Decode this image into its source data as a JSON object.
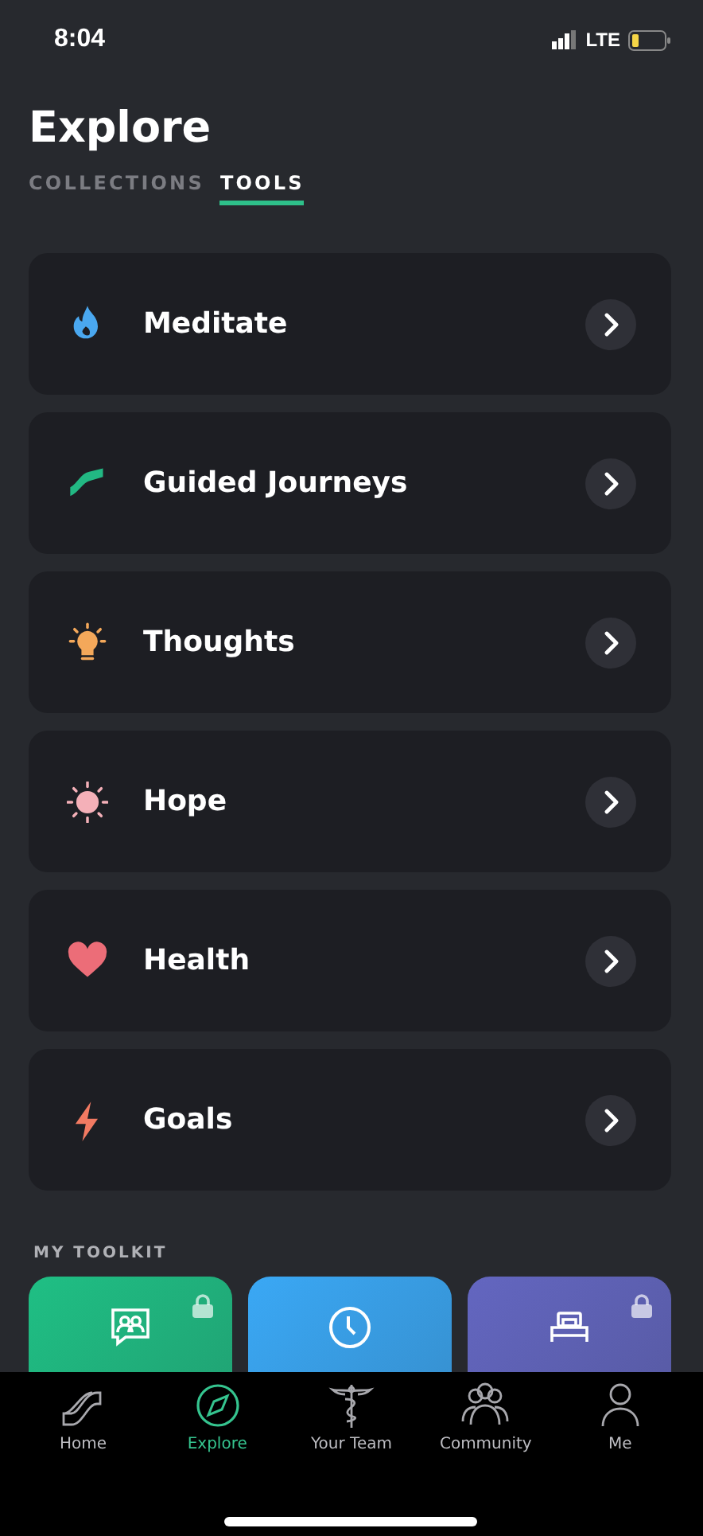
{
  "status_bar": {
    "time": "8:04",
    "network": "LTE"
  },
  "title": "Explore",
  "tabs": [
    {
      "label": "COLLECTIONS",
      "selected": false
    },
    {
      "label": "TOOLS",
      "selected": true
    }
  ],
  "tools": [
    {
      "label": "Meditate",
      "kind": "flame"
    },
    {
      "label": "Guided Journeys",
      "kind": "path"
    },
    {
      "label": "Thoughts",
      "kind": "bulb"
    },
    {
      "label": "Hope",
      "kind": "sun"
    },
    {
      "label": "Health",
      "kind": "heart"
    },
    {
      "label": "Goals",
      "kind": "bolt"
    }
  ],
  "toolkit": {
    "heading": "MY TOOLKIT",
    "tiles": [
      {
        "kind": "chat",
        "color": "#1fbf84",
        "locked": true
      },
      {
        "kind": "clock",
        "color": "#3aa8f5",
        "locked": false
      },
      {
        "kind": "bed",
        "color": "#6366c0",
        "locked": true
      }
    ]
  },
  "nav": [
    {
      "label": "Home",
      "kind": "home",
      "selected": false
    },
    {
      "label": "Explore",
      "kind": "compass",
      "selected": true
    },
    {
      "label": "Your Team",
      "kind": "caduceus",
      "selected": false
    },
    {
      "label": "Community",
      "kind": "people",
      "selected": false
    },
    {
      "label": "Me",
      "kind": "person",
      "selected": false
    }
  ]
}
